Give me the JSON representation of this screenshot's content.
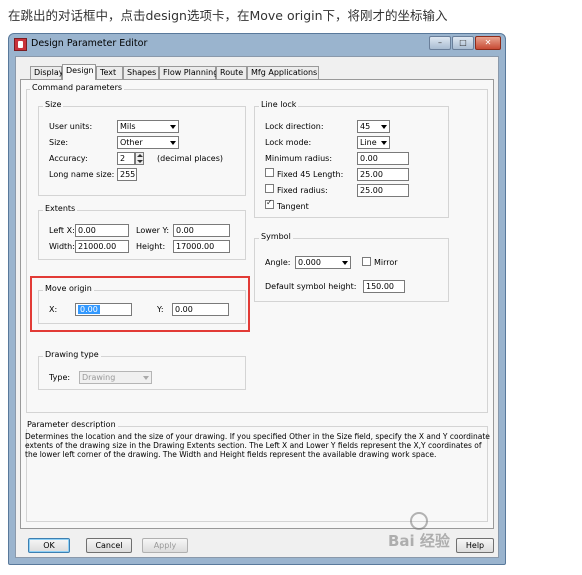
{
  "caption": "在跳出的对话框中，点击design选项卡，在Move origin下，将刚才的坐标输入",
  "window": {
    "title": "Design Parameter Editor",
    "min_glyph": "–",
    "max_glyph": "□",
    "close_glyph": "✕"
  },
  "tabs": [
    "Display",
    "Design",
    "Text",
    "Shapes",
    "Flow Planning",
    "Route",
    "Mfg Applications"
  ],
  "command_parameters": {
    "label": "Command parameters"
  },
  "size": {
    "label": "Size",
    "user_units_label": "User units:",
    "user_units_value": "Mils",
    "size_label": "Size:",
    "size_value": "Other",
    "accuracy_label": "Accuracy:",
    "accuracy_value": "2",
    "accuracy_suffix": "(decimal places)",
    "long_name_label": "Long name size:",
    "long_name_value": "255"
  },
  "extents": {
    "label": "Extents",
    "left_x_label": "Left X:",
    "left_x_value": "0.00",
    "lower_y_label": "Lower Y:",
    "lower_y_value": "0.00",
    "width_label": "Width:",
    "width_value": "21000.00",
    "height_label": "Height:",
    "height_value": "17000.00"
  },
  "move_origin": {
    "label": "Move origin",
    "x_label": "X:",
    "x_value": "0.00",
    "y_label": "Y:",
    "y_value": "0.00"
  },
  "drawing_type": {
    "label": "Drawing type",
    "type_label": "Type:",
    "type_value": "Drawing"
  },
  "line_lock": {
    "label": "Line lock",
    "lock_direction_label": "Lock direction:",
    "lock_direction_value": "45",
    "lock_mode_label": "Lock mode:",
    "lock_mode_value": "Line",
    "min_radius_label": "Minimum radius:",
    "min_radius_value": "0.00",
    "fixed45_label": "Fixed 45 Length:",
    "fixed45_value": "25.00",
    "fixed45_checked": false,
    "fixed_radius_label": "Fixed radius:",
    "fixed_radius_value": "25.00",
    "fixed_radius_checked": false,
    "tangent_label": "Tangent",
    "tangent_checked": true
  },
  "symbol": {
    "label": "Symbol",
    "angle_label": "Angle:",
    "angle_value": "0.000",
    "mirror_label": "Mirror",
    "mirror_checked": false,
    "default_height_label": "Default symbol height:",
    "default_height_value": "150.00"
  },
  "description": {
    "label": "Parameter description",
    "line1": "Determines the location and the size of your drawing. If you specified Other in the Size field, specify the X and Y coordinate",
    "line2": "extents of the drawing size in the Drawing Extents section. The Left X and Lower Y fields represent the X,Y coordinates of",
    "line3": "the lower left corner of the drawing. The Width and Height fields represent the available drawing work space."
  },
  "buttons": {
    "ok": "OK",
    "cancel": "Cancel",
    "apply": "Apply",
    "help": "Help"
  },
  "watermark": "Bai 经验"
}
